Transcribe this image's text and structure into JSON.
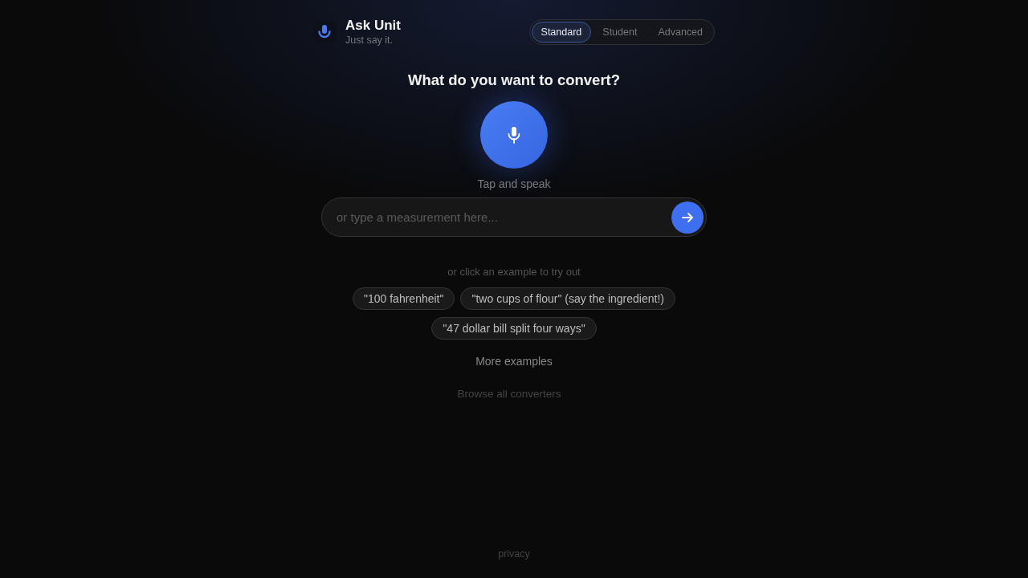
{
  "header": {
    "title": "Ask Unit",
    "tagline": "Just say it."
  },
  "modes": [
    {
      "label": "Standard",
      "selected": true
    },
    {
      "label": "Student",
      "selected": false
    },
    {
      "label": "Advanced",
      "selected": false
    }
  ],
  "prompt": {
    "heading": "What do you want to convert?",
    "mic_caption": "Tap and speak"
  },
  "input": {
    "placeholder": "or type a measurement here..."
  },
  "examples": {
    "hint": "or click an example to try out",
    "items": [
      "\"100 fahrenheit\"",
      "\"two cups of flour\" (say the ingredient!)",
      "\"47 dollar bill split four ways\""
    ],
    "more": "More examples"
  },
  "browse_link": "Browse all converters",
  "footer": {
    "privacy": "privacy"
  }
}
